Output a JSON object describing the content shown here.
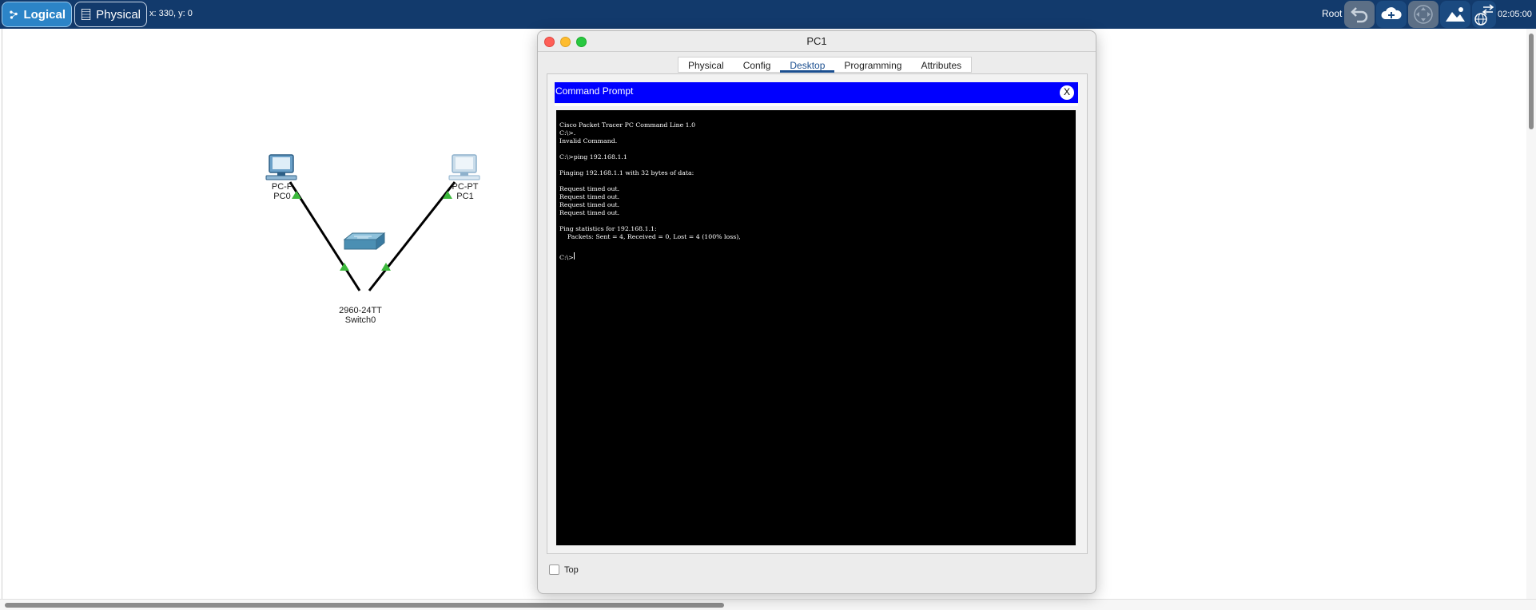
{
  "toolbar": {
    "logical_label": "Logical",
    "physical_label": "Physical",
    "coords": "x: 330, y: 0",
    "user": "Root",
    "clock": "02:05:00",
    "icons": [
      "undo-icon",
      "cloud-add-icon",
      "navigate-icon",
      "background-image-icon",
      "network-settings-icon"
    ]
  },
  "topology": {
    "devices": [
      {
        "model": "PC-PT",
        "name": "PC0",
        "icon": "pc-icon"
      },
      {
        "model": "PC-PT",
        "name": "PC1",
        "icon": "pc-icon"
      },
      {
        "model": "2960-24TT",
        "name": "Switch0",
        "icon": "switch-icon"
      }
    ],
    "pc0_model_visible": "PC-P",
    "link_status_color": "#3cb83c"
  },
  "dialog": {
    "title": "PC1",
    "tabs": [
      "Physical",
      "Config",
      "Desktop",
      "Programming",
      "Attributes"
    ],
    "active_tab": "Desktop",
    "app_title": "Command Prompt",
    "close_label": "X",
    "terminal_lines": [
      "Cisco Packet Tracer PC Command Line 1.0",
      "C:\\>.",
      "Invalid Command.",
      "",
      "C:\\>ping 192.168.1.1",
      "",
      "Pinging 192.168.1.1 with 32 bytes of data:",
      "",
      "Request timed out.",
      "Request timed out.",
      "Request timed out.",
      "Request timed out.",
      "",
      "Ping statistics for 192.168.1.1:",
      "    Packets: Sent = 4, Received = 0, Lost = 4 (100% loss),",
      "",
      "C:\\>"
    ],
    "top_checkbox_label": "Top",
    "top_checked": false
  },
  "colors": {
    "toolbar_bg": "#123a6c",
    "active_mode": "#2c84c7",
    "command_prompt_bar": "#0000ff",
    "terminal_bg": "#000000",
    "close_light": "#fe5f57",
    "minimize_light": "#febc2e",
    "zoom_light": "#28c840"
  }
}
